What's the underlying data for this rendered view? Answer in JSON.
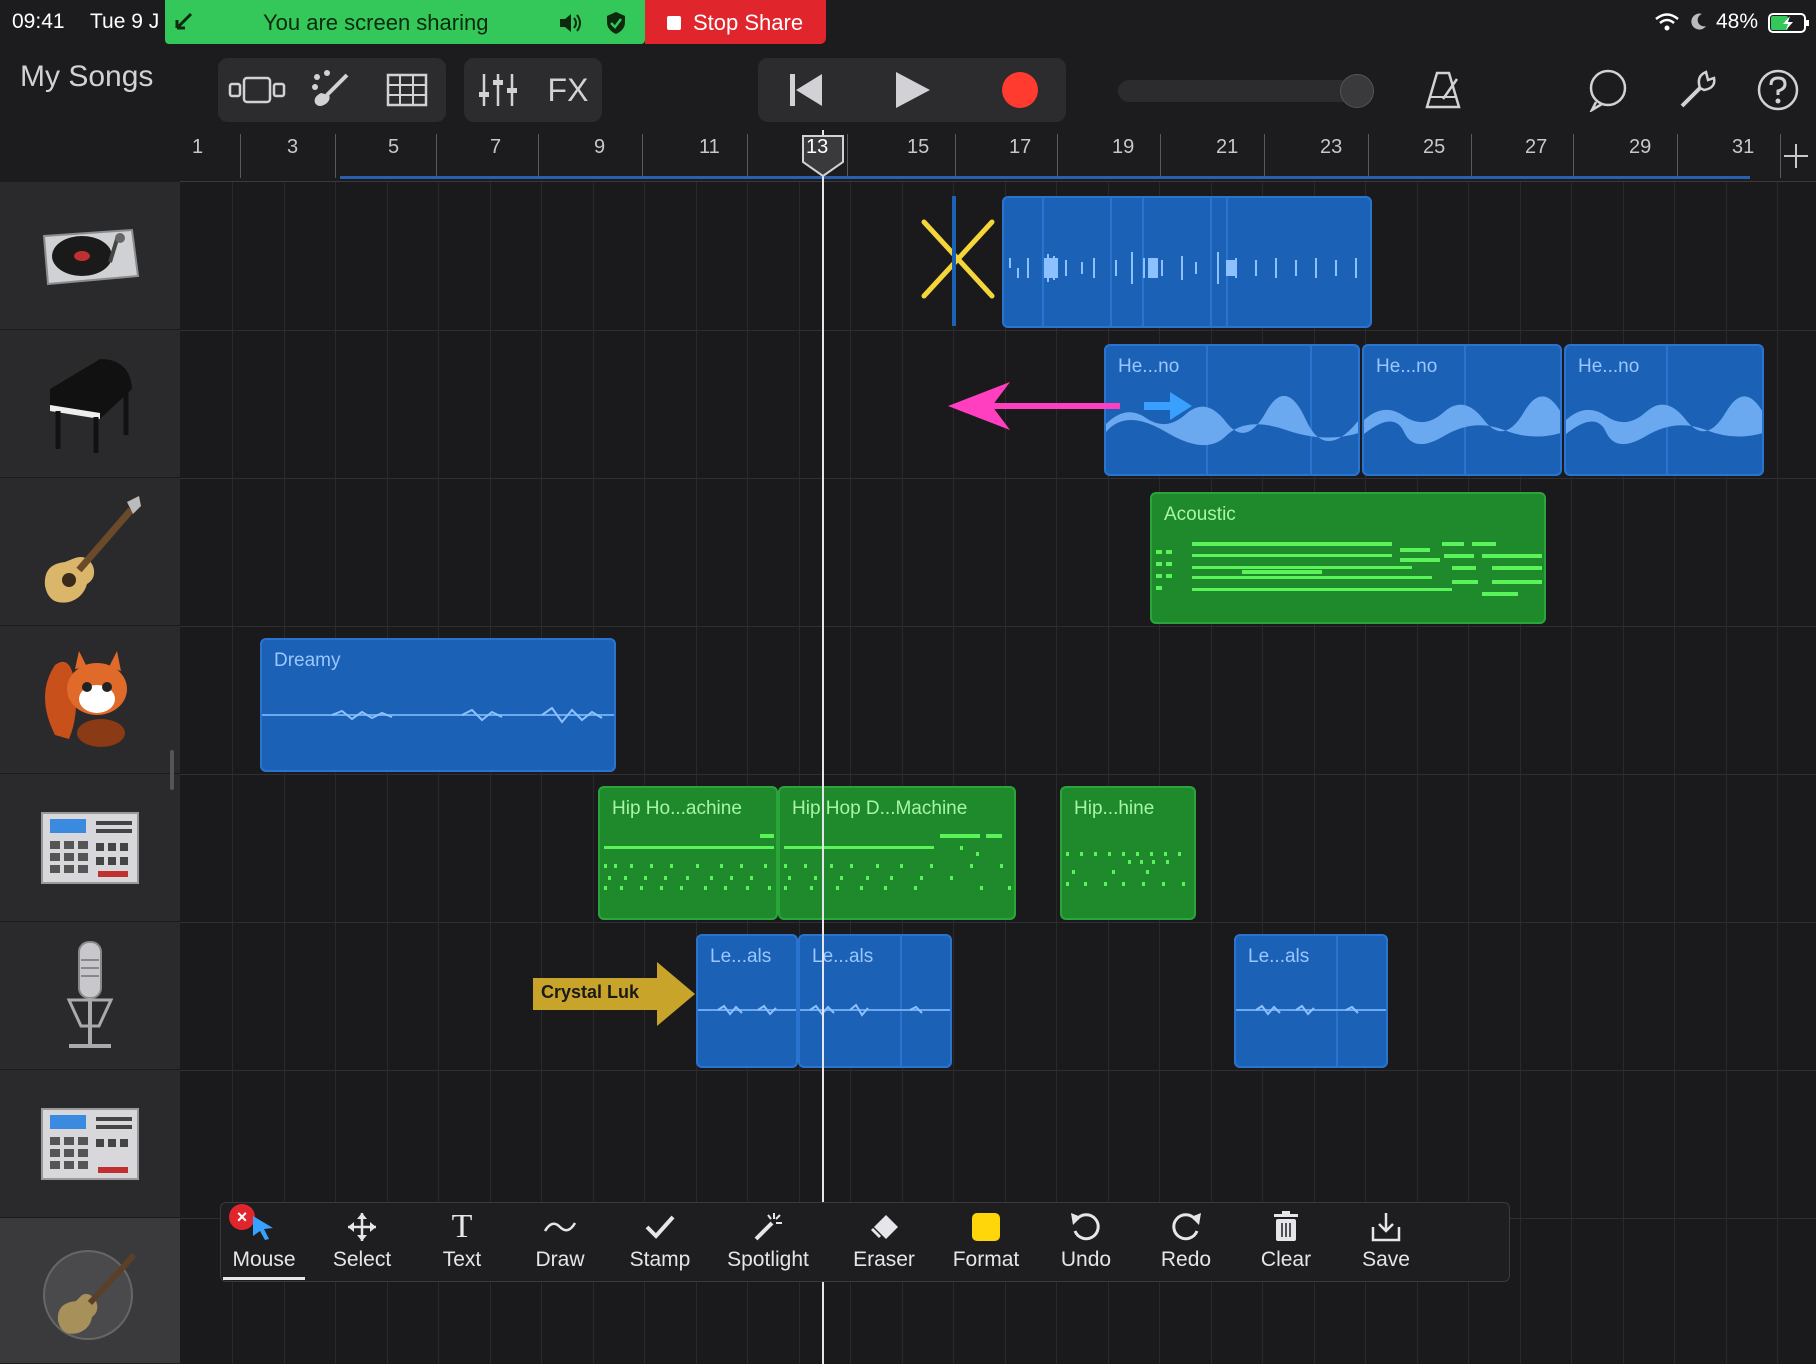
{
  "status_bar": {
    "time": "09:41",
    "date": "Tue 9 J",
    "battery": "48%",
    "sharing_text": "You are screen sharing",
    "stop_share_label": "Stop Share"
  },
  "toolbar": {
    "my_songs_label": "My Songs",
    "fx_label": "FX"
  },
  "ruler": {
    "bars": [
      "1",
      "3",
      "5",
      "7",
      "9",
      "11",
      "13",
      "15",
      "17",
      "19",
      "21",
      "23",
      "25",
      "27",
      "29",
      "31"
    ]
  },
  "tracks": [
    {
      "instrument": "turntable-icon"
    },
    {
      "instrument": "grand-piano-icon"
    },
    {
      "instrument": "acoustic-guitar-icon"
    },
    {
      "instrument": "squirrel-drummer-icon"
    },
    {
      "instrument": "drum-machine-icon"
    },
    {
      "instrument": "microphone-icon"
    },
    {
      "instrument": "drum-machine-icon"
    },
    {
      "instrument": "guitar-amp-icon"
    }
  ],
  "regions": {
    "piano_1": "He...no",
    "piano_2": "He...no",
    "piano_3": "He...no",
    "acoustic": "Acoustic",
    "dreamy": "Dreamy",
    "hiphop_1": "Hip Ho...achine",
    "hiphop_2": "Hip Hop D...Machine",
    "hiphop_3": "Hip...hine",
    "vocals_1": "Le...als",
    "vocals_2": "Le...als",
    "vocals_3": "Le...als"
  },
  "annotation": {
    "name_tag": "Crystal Luk",
    "tools": [
      {
        "label": "Mouse",
        "icon": "arrow-cursor-icon"
      },
      {
        "label": "Select",
        "icon": "move-arrows-icon"
      },
      {
        "label": "Text",
        "icon": "text-t-icon"
      },
      {
        "label": "Draw",
        "icon": "squiggle-icon"
      },
      {
        "label": "Stamp",
        "icon": "checkmark-icon"
      },
      {
        "label": "Spotlight",
        "icon": "magic-wand-icon"
      },
      {
        "label": "Eraser",
        "icon": "eraser-icon"
      },
      {
        "label": "Format",
        "icon": "yellow-square-icon"
      },
      {
        "label": "Undo",
        "icon": "undo-icon"
      },
      {
        "label": "Redo",
        "icon": "redo-icon"
      },
      {
        "label": "Clear",
        "icon": "trash-icon"
      },
      {
        "label": "Save",
        "icon": "save-icon"
      }
    ]
  },
  "colors": {
    "accent_blue_region": "#1b61b6",
    "accent_green_region": "#1e8a2c",
    "share_green": "#34c759",
    "stop_red": "#e0252d",
    "record_red": "#ff3b30",
    "annotation_yellow": "#f5d53a",
    "annotation_pink": "#ff3fbf"
  }
}
